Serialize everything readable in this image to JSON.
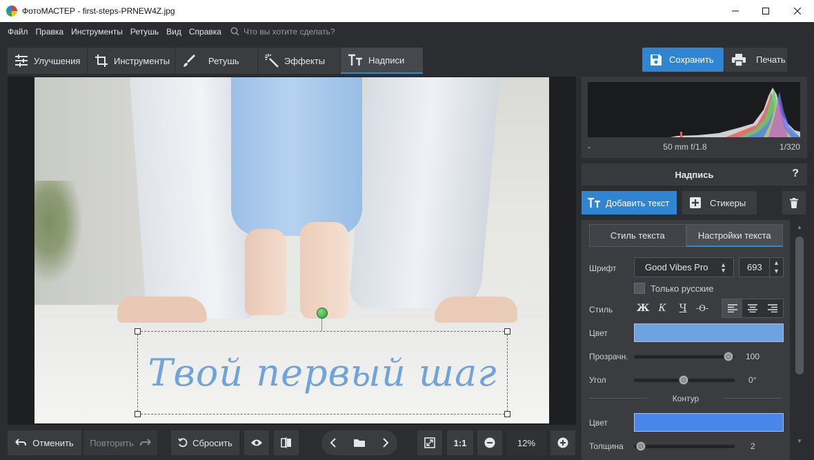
{
  "window": {
    "title": "ФотоМАСТЕР - first-steps-PRNEW4Z.jpg",
    "minimize_icon": "minimize-icon",
    "maximize_icon": "maximize-icon",
    "close_icon": "close-icon"
  },
  "menu": {
    "items": [
      "Файл",
      "Правка",
      "Инструменты",
      "Ретушь",
      "Вид",
      "Справка"
    ],
    "search_placeholder": "Что вы хотите сделать?"
  },
  "tabs": [
    {
      "label": "Улучшения",
      "icon": "sliders-icon"
    },
    {
      "label": "Инструменты",
      "icon": "crop-icon"
    },
    {
      "label": "Ретушь",
      "icon": "brush-icon"
    },
    {
      "label": "Эффекты",
      "icon": "magic-wand-icon"
    },
    {
      "label": "Надписи",
      "icon": "text-icon",
      "active": true
    }
  ],
  "toolbar": {
    "save_label": "Сохранить",
    "print_label": "Печать"
  },
  "canvas": {
    "overlay_text": "Твой первый шаг",
    "overlay_text_color": "#6fa3d9"
  },
  "bottom": {
    "undo_label": "Отменить",
    "redo_label": "Повторить",
    "reset_label": "Сбросить",
    "zoom_ratio_label": "1:1",
    "zoom_level": "12%"
  },
  "histogram": {
    "left": "-",
    "center": "50 mm f/1.8",
    "right": "1/320"
  },
  "panel": {
    "title": "Надпись",
    "help": "?",
    "add_text_label": "Добавить текст",
    "stickers_label": "Стикеры",
    "subtabs": [
      "Стиль текста",
      "Настройки текста"
    ],
    "font_label": "Шрифт",
    "font_value": "Good Vibes Pro",
    "size_value": "693",
    "only_russian_label": "Только русские",
    "style_label": "Стиль",
    "style_buttons": [
      "Ж",
      "К",
      "Ч",
      "-Ѳ-"
    ],
    "color_label": "Цвет",
    "text_color": "#6fa3e0",
    "opacity_label": "Прозрачн.",
    "opacity_value": "100",
    "angle_label": "Угол",
    "angle_value": "0°",
    "contour_label": "Контур",
    "contour_color_label": "Цвет",
    "contour_color": "#4a86e8",
    "thickness_label": "Толщина",
    "thickness_value": "2"
  },
  "colors": {
    "accent": "#2f85d1",
    "background": "#2b2d30",
    "panel": "#3a3c40"
  }
}
